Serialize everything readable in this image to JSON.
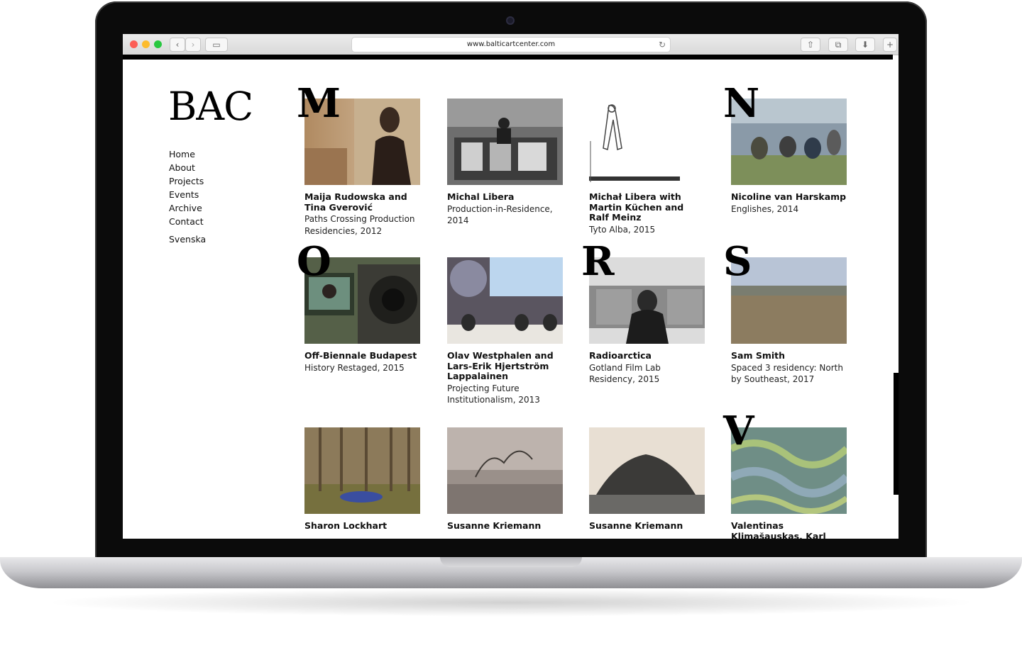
{
  "browser": {
    "url": "www.balticartcenter.com"
  },
  "site": {
    "logo": "BAC",
    "nav": [
      "Home",
      "About",
      "Projects",
      "Events",
      "Archive",
      "Contact"
    ],
    "lang": "Svenska"
  },
  "letters": [
    "M",
    "N",
    "O",
    "R",
    "S",
    "V"
  ],
  "cards": [
    {
      "title": "Maija Rudowska and Tina Gverović",
      "subtitle": "Paths Crossing Production Residencies, 2012"
    },
    {
      "title": "Michal Libera",
      "subtitle": "Production-in-Residence, 2014"
    },
    {
      "title": "Michał Libera with Martin Küchen and Ralf Meinz",
      "subtitle": "Tyto Alba, 2015"
    },
    {
      "title": "Nicoline van Harskamp",
      "subtitle": "Englishes, 2014"
    },
    {
      "title": "Off-Biennale Budapest",
      "subtitle": "History Restaged, 2015"
    },
    {
      "title": "Olav Westphalen and Lars-Erik Hjertström Lappalainen",
      "subtitle": "Projecting Future Institutionalism, 2013"
    },
    {
      "title": "Radioarctica",
      "subtitle": "Gotland Film Lab Residency, 2015"
    },
    {
      "title": "Sam Smith",
      "subtitle": "Spaced 3 residency: North by Southeast, 2017"
    },
    {
      "title": "Sharon Lockhart",
      "subtitle": ""
    },
    {
      "title": "Susanne Kriemann",
      "subtitle": ""
    },
    {
      "title": "Susanne Kriemann",
      "subtitle": ""
    },
    {
      "title": "Valentinas Klimas̆auskas, Karl",
      "subtitle": ""
    }
  ]
}
